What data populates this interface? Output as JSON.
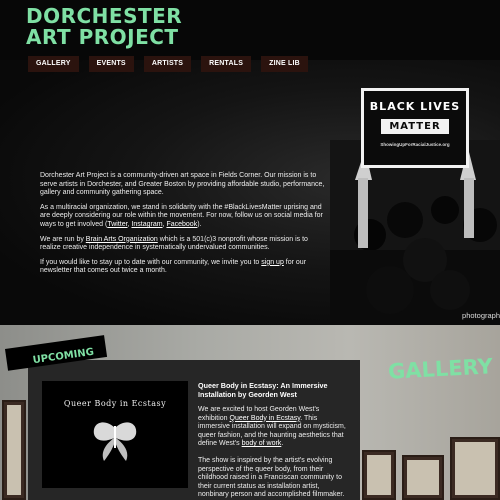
{
  "brand": {
    "line1": "DORCHESTER",
    "line2": "ART PROJECT",
    "accent": "#7fe0a4"
  },
  "nav": {
    "items": [
      {
        "label": "GALLERY"
      },
      {
        "label": "EVENTS"
      },
      {
        "label": "ARTISTS"
      },
      {
        "label": "RENTALS"
      },
      {
        "label": "ZINE LIB"
      }
    ],
    "bg": "#2b130e"
  },
  "hero": {
    "sign": {
      "line1": "BLACK LIVES",
      "line2": "MATTER",
      "line3": "ShowingUpForRacialJustice.org"
    },
    "photo_credit": "photograph",
    "about": {
      "p1": "Dorchester Art Project is a community-driven art space in Fields Corner. Our mission is to serve artists in Dorchester, and Greater Boston by providing affordable studio, performance, gallery and community gathering space.",
      "p2_pre": "As a multiracial organization, we stand in solidarity with the #BlackLivesMatter uprising and are deeply considering our role within the movement. For now, follow us on social media for ways to get involved (",
      "twitter": "Twitter",
      "instagram": "Instagram",
      "facebook": "Facebook",
      "p2_post": ").",
      "p3_pre": "We are run by ",
      "bao_link": "Brain Arts Organization",
      "p3_post": " which is a 501(c)3 nonprofit whose mission is to realize creative independence in systematically undervalued communities.",
      "p4_pre": "If you would like to stay up to date with our community, we invite you to ",
      "signup_link": "sign up",
      "p4_post": " for our newsletter that comes out twice a month."
    }
  },
  "upcoming": {
    "label": "UPCOMING",
    "poster_title": "Queer Body in Ecstasy",
    "event_title": "Queer Body in Ecstasy: An Immersive Installation by Georden West",
    "p1_pre": "We are excited to host Georden West's exhibition ",
    "p1_link": "Queer Body in Ecstasy",
    "p1_post": ". This immersive installation will expand on mysticism, queer fashion, and the haunting aesthetics that define West's ",
    "body_link": "body of work",
    "p1_end": ".",
    "p2": "The show is inspired by the artist's evolving perspective of the queer body, from their childhood raised in a Franciscan community to their current status as installation artist, nonbinary person and accomplished filmmaker. \"Patron Saint\" their most recent work, was"
  },
  "gallery": {
    "title": "GALLERY"
  }
}
